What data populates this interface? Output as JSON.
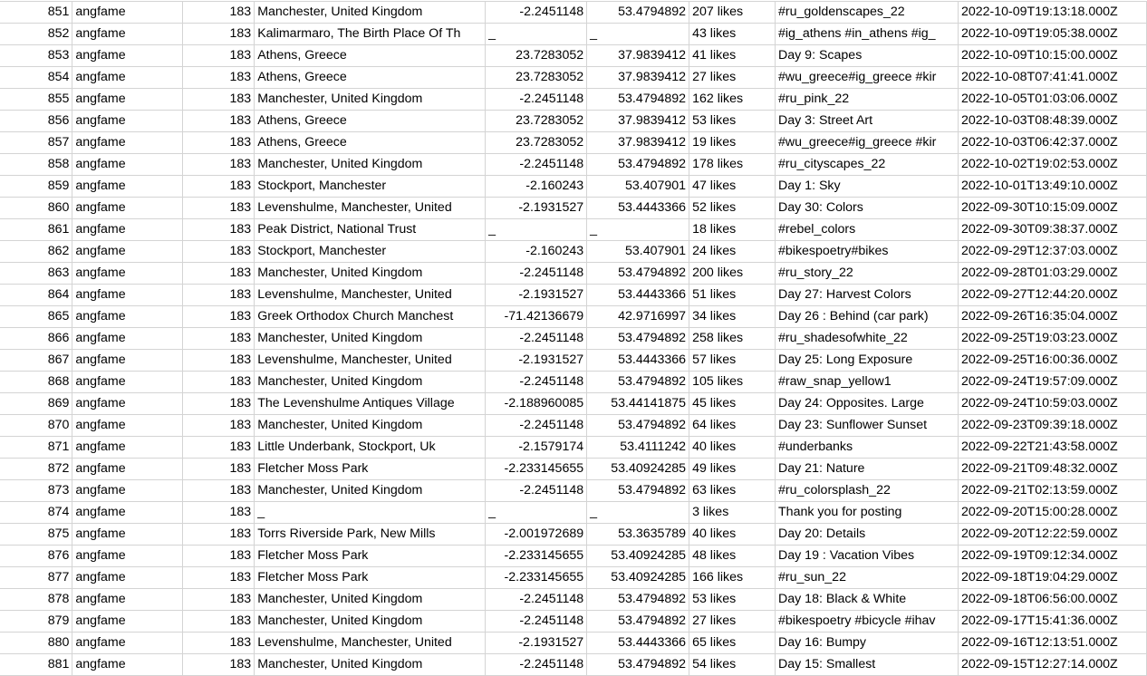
{
  "sheet": {
    "rows": [
      [
        "851",
        "angfame",
        "183",
        "Manchester, United Kingdom",
        "-2.2451148",
        "53.4794892",
        "207 likes",
        "#ru_goldenscapes_22",
        "2022-10-09T19:13:18.000Z"
      ],
      [
        "852",
        "angfame",
        "183",
        "Kalimarmaro, The Birth Place Of Th",
        "_",
        "_",
        "43 likes",
        "#ig_athens #in_athens #ig_",
        "2022-10-09T19:05:38.000Z"
      ],
      [
        "853",
        "angfame",
        "183",
        "Athens, Greece",
        "23.7283052",
        "37.9839412",
        "41 likes",
        "Day 9: Scapes",
        "2022-10-09T10:15:00.000Z"
      ],
      [
        "854",
        "angfame",
        "183",
        "Athens, Greece",
        "23.7283052",
        "37.9839412",
        "27 likes",
        "#wu_greece#ig_greece #kir",
        "2022-10-08T07:41:41.000Z"
      ],
      [
        "855",
        "angfame",
        "183",
        "Manchester, United Kingdom",
        "-2.2451148",
        "53.4794892",
        "162 likes",
        "#ru_pink_22",
        "2022-10-05T01:03:06.000Z"
      ],
      [
        "856",
        "angfame",
        "183",
        "Athens, Greece",
        "23.7283052",
        "37.9839412",
        "53 likes",
        "Day 3: Street Art",
        "2022-10-03T08:48:39.000Z"
      ],
      [
        "857",
        "angfame",
        "183",
        "Athens, Greece",
        "23.7283052",
        "37.9839412",
        "19 likes",
        "#wu_greece#ig_greece #kir",
        "2022-10-03T06:42:37.000Z"
      ],
      [
        "858",
        "angfame",
        "183",
        "Manchester, United Kingdom",
        "-2.2451148",
        "53.4794892",
        "178 likes",
        "#ru_cityscapes_22",
        "2022-10-02T19:02:53.000Z"
      ],
      [
        "859",
        "angfame",
        "183",
        "Stockport, Manchester",
        "-2.160243",
        "53.407901",
        "47 likes",
        "Day 1: Sky",
        "2022-10-01T13:49:10.000Z"
      ],
      [
        "860",
        "angfame",
        "183",
        "Levenshulme, Manchester, United",
        "-2.1931527",
        "53.4443366",
        "52 likes",
        "Day 30: Colors",
        "2022-09-30T10:15:09.000Z"
      ],
      [
        "861",
        "angfame",
        "183",
        "Peak District, National Trust",
        "_",
        "_",
        "18 likes",
        "#rebel_colors",
        "2022-09-30T09:38:37.000Z"
      ],
      [
        "862",
        "angfame",
        "183",
        "Stockport, Manchester",
        "-2.160243",
        "53.407901",
        "24 likes",
        "#bikespoetry#bikes",
        "2022-09-29T12:37:03.000Z"
      ],
      [
        "863",
        "angfame",
        "183",
        "Manchester, United Kingdom",
        "-2.2451148",
        "53.4794892",
        "200 likes",
        "#ru_story_22",
        "2022-09-28T01:03:29.000Z"
      ],
      [
        "864",
        "angfame",
        "183",
        "Levenshulme, Manchester, United",
        "-2.1931527",
        "53.4443366",
        "51 likes",
        "Day 27: Harvest Colors",
        "2022-09-27T12:44:20.000Z"
      ],
      [
        "865",
        "angfame",
        "183",
        "Greek Orthodox Church Manchest",
        "-71.42136679",
        "42.9716997",
        "34 likes",
        "Day 26 : Behind (car park)",
        "2022-09-26T16:35:04.000Z"
      ],
      [
        "866",
        "angfame",
        "183",
        "Manchester, United Kingdom",
        "-2.2451148",
        "53.4794892",
        "258 likes",
        "#ru_shadesofwhite_22",
        "2022-09-25T19:03:23.000Z"
      ],
      [
        "867",
        "angfame",
        "183",
        "Levenshulme, Manchester, United",
        "-2.1931527",
        "53.4443366",
        "57 likes",
        "Day 25: Long Exposure",
        "2022-09-25T16:00:36.000Z"
      ],
      [
        "868",
        "angfame",
        "183",
        "Manchester, United Kingdom",
        "-2.2451148",
        "53.4794892",
        "105 likes",
        "#raw_snap_yellow1",
        "2022-09-24T19:57:09.000Z"
      ],
      [
        "869",
        "angfame",
        "183",
        "The Levenshulme Antiques Village",
        "-2.188960085",
        "53.44141875",
        "45 likes",
        "Day 24: Opposites. Large",
        "2022-09-24T10:59:03.000Z"
      ],
      [
        "870",
        "angfame",
        "183",
        "Manchester, United Kingdom",
        "-2.2451148",
        "53.4794892",
        "64 likes",
        "Day 23: Sunflower Sunset",
        "2022-09-23T09:39:18.000Z"
      ],
      [
        "871",
        "angfame",
        "183",
        "Little Underbank, Stockport, Uk",
        "-2.1579174",
        "53.4111242",
        "40 likes",
        "#underbanks",
        "2022-09-22T21:43:58.000Z"
      ],
      [
        "872",
        "angfame",
        "183",
        "Fletcher Moss Park",
        "-2.233145655",
        "53.40924285",
        "49 likes",
        "Day 21: Nature",
        "2022-09-21T09:48:32.000Z"
      ],
      [
        "873",
        "angfame",
        "183",
        "Manchester, United Kingdom",
        "-2.2451148",
        "53.4794892",
        "63 likes",
        "#ru_colorsplash_22",
        "2022-09-21T02:13:59.000Z"
      ],
      [
        "874",
        "angfame",
        "183",
        "_",
        "_",
        "_",
        "3 likes",
        "Thank you for posting",
        "2022-09-20T15:00:28.000Z"
      ],
      [
        "875",
        "angfame",
        "183",
        "Torrs Riverside Park, New Mills",
        "-2.001972689",
        "53.3635789",
        "40 likes",
        "Day 20: Details",
        "2022-09-20T12:22:59.000Z"
      ],
      [
        "876",
        "angfame",
        "183",
        "Fletcher Moss Park",
        "-2.233145655",
        "53.40924285",
        "48 likes",
        "Day 19 : Vacation Vibes",
        "2022-09-19T09:12:34.000Z"
      ],
      [
        "877",
        "angfame",
        "183",
        "Fletcher Moss Park",
        "-2.233145655",
        "53.40924285",
        "166 likes",
        "#ru_sun_22",
        "2022-09-18T19:04:29.000Z"
      ],
      [
        "878",
        "angfame",
        "183",
        "Manchester, United Kingdom",
        "-2.2451148",
        "53.4794892",
        "53 likes",
        "Day 18: Black & White",
        "2022-09-18T06:56:00.000Z"
      ],
      [
        "879",
        "angfame",
        "183",
        "Manchester, United Kingdom",
        "-2.2451148",
        "53.4794892",
        "27 likes",
        "#bikespoetry #bicycle #ihav",
        "2022-09-17T15:41:36.000Z"
      ],
      [
        "880",
        "angfame",
        "183",
        "Levenshulme, Manchester, United",
        "-2.1931527",
        "53.4443366",
        "65 likes",
        "Day 16: Bumpy",
        "2022-09-16T12:13:51.000Z"
      ],
      [
        "881",
        "angfame",
        "183",
        "Manchester, United Kingdom",
        "-2.2451148",
        "53.4794892",
        "54 likes",
        "Day 15: Smallest",
        "2022-09-15T12:27:14.000Z"
      ]
    ]
  }
}
